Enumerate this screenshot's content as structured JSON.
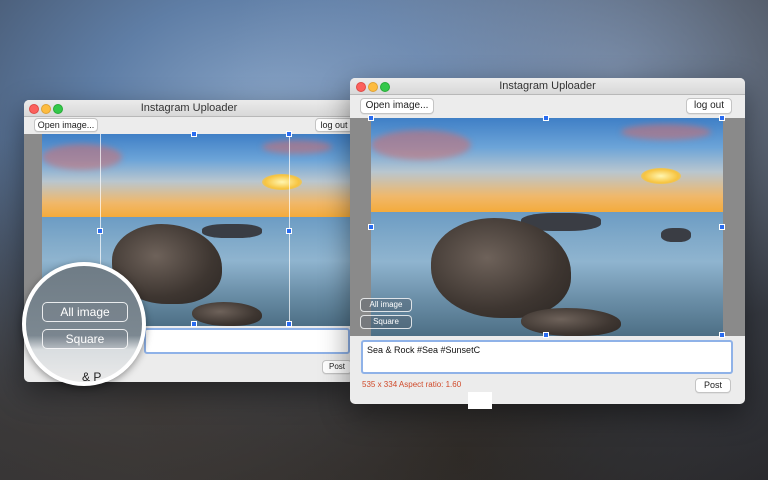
{
  "back_window": {
    "title": "Instagram Uploader",
    "open_label": "Open image...",
    "logout_label": "log out",
    "post_label": "Post"
  },
  "front_window": {
    "title": "Instagram Uploader",
    "open_label": "Open image...",
    "logout_label": "log out",
    "crop_options": [
      "All image",
      "Square"
    ],
    "caption_value": "Sea & Rock #Sea #SunsetC",
    "size_ratio_text": "535 x 334 Aspect ratio: 1.60",
    "post_label": "Post"
  },
  "magnifier": {
    "options": [
      "All image",
      "Square"
    ],
    "partial_text": "& P"
  },
  "colors": {
    "accent": "#2a6cf0",
    "ratio_text": "#d04a2a",
    "caption_border": "#8fb2e8"
  }
}
